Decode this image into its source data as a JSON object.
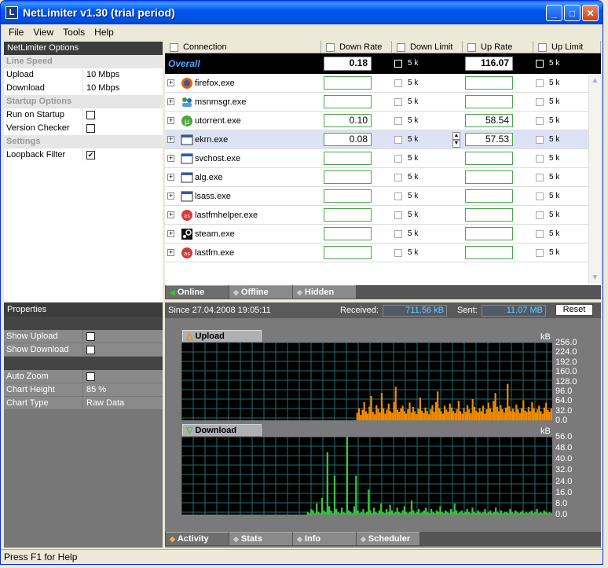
{
  "window": {
    "title": "NetLimiter v1.30 (trial period)",
    "icon": "L"
  },
  "title_buttons": {
    "minimize": "_",
    "maximize": "□",
    "close": "✕"
  },
  "menu": [
    "File",
    "View",
    "Tools",
    "Help"
  ],
  "options_panel": {
    "header": "NetLimiter Options",
    "sections": [
      {
        "title": "Line Speed",
        "rows": [
          {
            "key": "Upload",
            "value": "10 Mbps"
          },
          {
            "key": "Download",
            "value": "10 Mbps"
          }
        ]
      },
      {
        "title": "Startup Options",
        "rows": [
          {
            "key": "Run on Startup",
            "checked": false
          },
          {
            "key": "Version Checker",
            "checked": false
          }
        ]
      },
      {
        "title": "Settings",
        "rows": [
          {
            "key": "Loopback Filter",
            "checked": true
          }
        ]
      }
    ]
  },
  "properties_panel": {
    "header": "Properties",
    "groups": [
      [
        {
          "key": "Show Upload",
          "checked": true
        },
        {
          "key": "Show Download",
          "checked": true
        }
      ],
      [
        {
          "key": "Auto Zoom",
          "checked": true
        },
        {
          "key": "Chart Height",
          "value": "85 %"
        },
        {
          "key": "Chart Type",
          "value": "Raw Data"
        }
      ]
    ]
  },
  "grid": {
    "columns": {
      "connection": "Connection",
      "down_rate": "Down Rate",
      "down_limit": "Down Limit",
      "up_rate": "Up Rate",
      "up_limit": "Up Limit"
    },
    "overall": {
      "label": "Overall",
      "down_rate": "0.18",
      "down_limit": "5 k",
      "up_rate": "116.07",
      "up_limit": "5 k"
    },
    "rows": [
      {
        "name": "firefox.exe",
        "icon": "firefox-icon",
        "down_rate": "",
        "down_limit": "5 k",
        "up_rate": "",
        "up_limit": "5 k"
      },
      {
        "name": "msnmsgr.exe",
        "icon": "msn-messenger-icon",
        "down_rate": "",
        "down_limit": "5 k",
        "up_rate": "",
        "up_limit": "5 k"
      },
      {
        "name": "utorrent.exe",
        "icon": "utorrent-icon",
        "down_rate": "0.10",
        "down_limit": "5 k",
        "up_rate": "58.54",
        "up_limit": "5 k"
      },
      {
        "name": "ekrn.exe",
        "icon": "window-icon",
        "down_rate": "0.08",
        "down_limit": "5 k",
        "up_rate": "57.53",
        "up_limit": "5 k",
        "selected": true
      },
      {
        "name": "svchost.exe",
        "icon": "window-icon",
        "down_rate": "",
        "down_limit": "5 k",
        "up_rate": "",
        "up_limit": "5 k"
      },
      {
        "name": "alg.exe",
        "icon": "window-icon",
        "down_rate": "",
        "down_limit": "5 k",
        "up_rate": "",
        "up_limit": "5 k"
      },
      {
        "name": "lsass.exe",
        "icon": "window-icon",
        "down_rate": "",
        "down_limit": "5 k",
        "up_rate": "",
        "up_limit": "5 k"
      },
      {
        "name": "lastfmhelper.exe",
        "icon": "lastfm-icon",
        "down_rate": "",
        "down_limit": "5 k",
        "up_rate": "",
        "up_limit": "5 k"
      },
      {
        "name": "steam.exe",
        "icon": "steam-icon",
        "down_rate": "",
        "down_limit": "5 k",
        "up_rate": "",
        "up_limit": "5 k"
      },
      {
        "name": "lastfm.exe",
        "icon": "lastfm-icon",
        "down_rate": "",
        "down_limit": "5 k",
        "up_rate": "",
        "up_limit": "5 k"
      }
    ]
  },
  "view_tabs": [
    "Online",
    "Offline",
    "Hidden"
  ],
  "activity": {
    "since": "Since 27.04.2008 19:05:11",
    "received_label": "Received:",
    "received": "711.56 kB",
    "sent_label": "Sent:",
    "sent": "11.07 MB",
    "reset": "Reset"
  },
  "chart_data": [
    {
      "type": "area",
      "title": "Upload",
      "ylabel": "kB",
      "yticks": [
        "256.0",
        "224.0",
        "192.0",
        "160.0",
        "128.0",
        "96.0",
        "64.0",
        "32.0",
        "0.0"
      ],
      "ylim": [
        0,
        256
      ],
      "color": "#f08a00",
      "values": [
        0,
        0,
        0,
        0,
        0,
        0,
        0,
        0,
        0,
        0,
        0,
        0,
        0,
        0,
        0,
        0,
        0,
        0,
        0,
        0,
        0,
        0,
        0,
        0,
        0,
        0,
        0,
        0,
        0,
        0,
        0,
        0,
        0,
        0,
        0,
        0,
        0,
        0,
        0,
        0,
        0,
        0,
        0,
        0,
        0,
        0,
        0,
        0,
        0,
        0,
        0,
        0,
        0,
        0,
        0,
        0,
        0,
        0,
        0,
        0,
        0,
        0,
        0,
        0,
        0,
        0,
        0,
        0,
        0,
        0,
        0,
        0,
        0,
        0,
        0,
        0,
        0,
        0,
        0,
        0,
        0,
        0,
        0,
        0,
        0,
        0,
        0,
        0,
        0,
        0,
        0,
        0,
        0,
        0,
        0,
        0,
        0,
        0,
        0,
        0,
        25,
        40,
        18,
        35,
        60,
        30,
        22,
        45,
        80,
        28,
        20,
        50,
        38,
        26,
        90,
        40,
        22,
        35,
        55,
        30,
        25,
        60,
        110,
        35,
        28,
        40,
        48,
        30,
        22,
        36,
        58,
        26,
        44,
        30,
        20,
        38,
        75,
        32,
        24,
        42,
        30,
        20,
        36,
        50,
        28,
        60,
        95,
        40,
        30,
        22,
        48,
        35,
        28,
        55,
        42,
        30,
        24,
        36,
        64,
        30,
        22,
        40,
        28,
        50,
        36,
        24,
        70,
        44,
        32,
        26,
        40,
        30,
        48,
        22,
        36,
        58,
        40,
        28,
        64,
        90,
        44,
        30,
        50,
        36,
        26,
        42,
        120,
        46,
        30,
        38,
        28,
        52,
        36,
        24,
        40,
        66,
        32,
        28,
        44,
        30,
        60,
        40,
        26,
        36,
        48,
        30,
        22,
        42,
        58,
        34,
        28,
        40
      ]
    },
    {
      "type": "area",
      "title": "Download",
      "ylabel": "kB",
      "yticks": [
        "56.0",
        "48.0",
        "40.0",
        "32.0",
        "24.0",
        "16.0",
        "8.0",
        "0.0"
      ],
      "ylim": [
        0,
        56
      ],
      "color": "#3cc23c",
      "values": [
        0,
        0,
        0,
        0,
        0,
        0,
        0,
        0,
        0,
        0,
        0,
        0,
        0,
        0,
        0,
        0,
        0,
        0,
        0,
        0,
        0,
        0,
        0,
        0,
        0,
        0,
        0,
        0,
        0,
        0,
        0,
        0,
        0,
        0,
        0,
        0,
        0,
        0,
        0,
        0,
        0,
        0,
        0,
        0,
        0,
        0,
        0,
        0,
        0,
        0,
        0,
        0,
        0,
        0,
        0,
        0,
        0,
        0,
        0,
        0,
        0,
        0,
        0,
        0,
        0,
        0,
        0,
        0,
        0,
        0,
        2,
        1,
        4,
        3,
        1,
        8,
        2,
        1,
        12,
        3,
        2,
        45,
        6,
        3,
        1,
        28,
        4,
        2,
        1,
        5,
        2,
        1,
        60,
        3,
        2,
        1,
        6,
        28,
        3,
        1,
        2,
        4,
        1,
        2,
        18,
        3,
        1,
        5,
        2,
        1,
        3,
        8,
        2,
        1,
        4,
        2,
        7,
        3,
        1,
        2,
        5,
        2,
        1,
        3,
        6,
        2,
        1,
        2,
        10,
        3,
        1,
        2,
        4,
        1,
        2,
        3,
        5,
        2,
        1,
        4,
        2,
        1,
        3,
        2,
        6,
        2,
        1,
        3,
        2,
        1,
        4,
        2,
        8,
        3,
        1,
        2,
        3,
        1,
        2,
        4,
        2,
        1,
        5,
        2,
        1,
        3,
        2,
        1,
        2,
        4,
        1,
        2,
        3,
        1,
        2,
        5,
        2,
        1,
        3,
        1,
        2,
        2,
        1,
        4,
        2,
        1,
        3,
        2,
        1,
        2,
        3,
        1,
        2,
        1,
        2,
        3,
        1,
        2,
        4,
        1,
        2,
        1,
        3,
        2,
        1,
        2,
        1
      ]
    }
  ],
  "bottom_tabs": [
    "Activity",
    "Stats",
    "Info",
    "Scheduler"
  ],
  "status_bar": "Press F1 for Help"
}
